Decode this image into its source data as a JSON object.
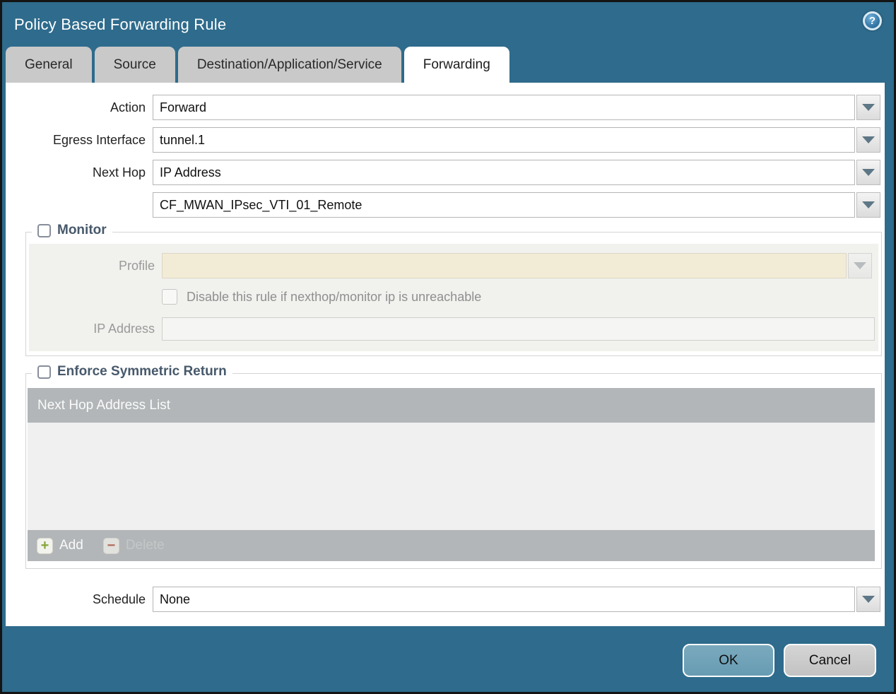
{
  "dialog": {
    "title": "Policy Based Forwarding Rule"
  },
  "tabs": [
    {
      "label": "General",
      "active": false
    },
    {
      "label": "Source",
      "active": false
    },
    {
      "label": "Destination/Application/Service",
      "active": false
    },
    {
      "label": "Forwarding",
      "active": true
    }
  ],
  "form": {
    "action": {
      "label": "Action",
      "value": "Forward"
    },
    "egress_interface": {
      "label": "Egress Interface",
      "value": "tunnel.1"
    },
    "next_hop": {
      "label": "Next Hop",
      "value": "IP Address"
    },
    "next_hop_address": {
      "value": "CF_MWAN_IPsec_VTI_01_Remote"
    },
    "schedule": {
      "label": "Schedule",
      "value": "None"
    }
  },
  "monitor": {
    "title": "Monitor",
    "checked": false,
    "profile": {
      "label": "Profile",
      "value": ""
    },
    "disable_rule": {
      "label": "Disable this rule if nexthop/monitor ip is unreachable",
      "checked": false
    },
    "ip_address": {
      "label": "IP Address",
      "value": ""
    }
  },
  "symmetric_return": {
    "title": "Enforce Symmetric Return",
    "checked": false,
    "list_header": "Next Hop Address List",
    "rows": [],
    "add_label": "Add",
    "delete_label": "Delete",
    "delete_enabled": false
  },
  "footer": {
    "ok": "OK",
    "cancel": "Cancel"
  },
  "colors": {
    "teal": "#2e6b8c",
    "tab-gray": "#c9c9c9",
    "table-gray": "#b2b6b8",
    "panel-gray": "#f1f1ee",
    "disabled-cream": "#f2ecd7",
    "ok-blue": "#679cb3",
    "section-title": "#47596b"
  }
}
